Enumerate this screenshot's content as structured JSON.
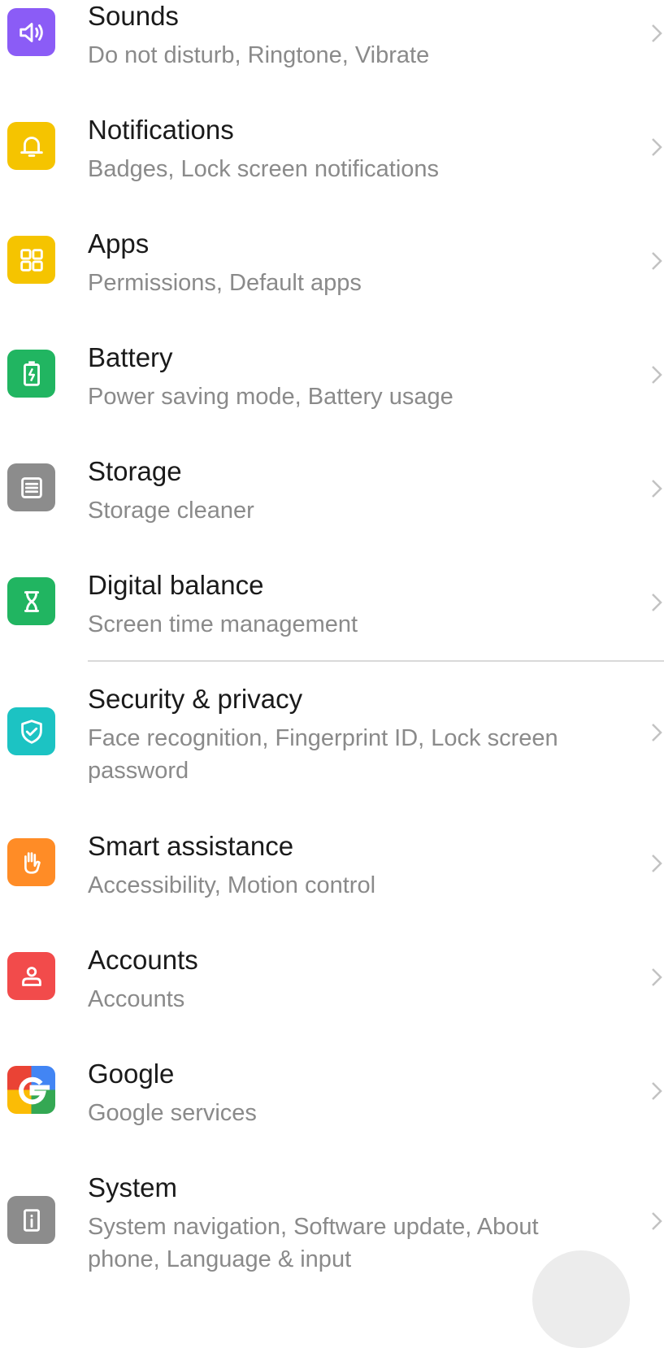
{
  "items": [
    {
      "title": "Sounds",
      "subtitle": "Do not disturb, Ringtone, Vibrate",
      "color": "#8b5cf6",
      "icon": "speaker-icon"
    },
    {
      "title": "Notifications",
      "subtitle": "Badges, Lock screen notifications",
      "color": "#f5c400",
      "icon": "bell-icon"
    },
    {
      "title": "Apps",
      "subtitle": "Permissions, Default apps",
      "color": "#f5c400",
      "icon": "apps-grid-icon"
    },
    {
      "title": "Battery",
      "subtitle": "Power saving mode, Battery usage",
      "color": "#21b561",
      "icon": "battery-icon"
    },
    {
      "title": "Storage",
      "subtitle": "Storage cleaner",
      "color": "#8c8c8c",
      "icon": "storage-icon"
    },
    {
      "title": "Digital balance",
      "subtitle": "Screen time management",
      "color": "#21b561",
      "icon": "hourglass-icon"
    },
    {
      "title": "Security & privacy",
      "subtitle": "Face recognition, Fingerprint ID, Lock screen password",
      "color": "#1cc3c3",
      "icon": "shield-check-icon"
    },
    {
      "title": "Smart assistance",
      "subtitle": "Accessibility, Motion control",
      "color": "#ff8c26",
      "icon": "hand-icon"
    },
    {
      "title": "Accounts",
      "subtitle": "Accounts",
      "color": "#f24b4b",
      "icon": "account-icon"
    },
    {
      "title": "Google",
      "subtitle": "Google services",
      "color": "#ffffff",
      "icon": "google-g-icon"
    },
    {
      "title": "System",
      "subtitle": "System navigation, Software update, About phone, Language & input",
      "color": "#8c8c8c",
      "icon": "system-info-icon"
    }
  ]
}
